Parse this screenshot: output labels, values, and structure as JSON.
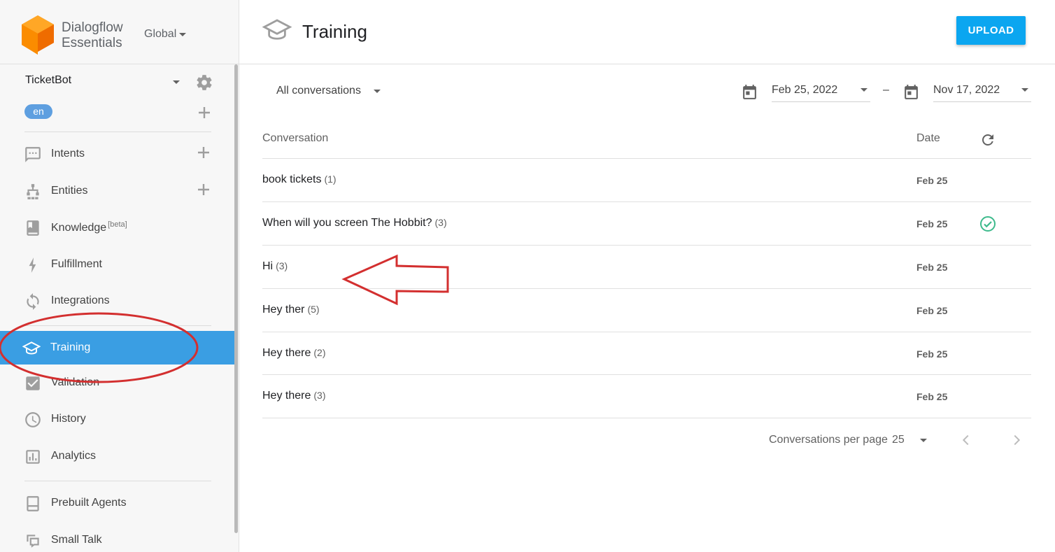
{
  "brand": {
    "name_line1": "Dialogflow",
    "name_line2": "Essentials",
    "region": "Global",
    "logo_color": "#f57c00"
  },
  "agent": {
    "name": "TicketBot",
    "language": "en"
  },
  "sidebar": {
    "items": [
      {
        "label": "Intents",
        "icon": "chat-bubble-icon",
        "has_add": true
      },
      {
        "label": "Entities",
        "icon": "hierarchy-icon",
        "has_add": true
      },
      {
        "label": "Knowledge",
        "badge": "[beta]",
        "icon": "book-icon"
      },
      {
        "label": "Fulfillment",
        "icon": "lightning-icon"
      },
      {
        "label": "Integrations",
        "icon": "sync-icon"
      },
      {
        "label": "Training",
        "icon": "graduation-cap-icon",
        "active": true
      },
      {
        "label": "Validation",
        "icon": "checkbox-icon"
      },
      {
        "label": "History",
        "icon": "clock-icon"
      },
      {
        "label": "Analytics",
        "icon": "bar-chart-icon"
      },
      {
        "label": "Prebuilt Agents",
        "icon": "bookmark-book-icon"
      },
      {
        "label": "Small Talk",
        "icon": "speech-bubbles-icon"
      }
    ],
    "active_color": "#3a9ee3"
  },
  "header": {
    "title": "Training",
    "upload_label": "UPLOAD",
    "upload_color": "#0ba6f0"
  },
  "filters": {
    "conversation_filter": "All conversations",
    "date_from": "Feb 25, 2022",
    "date_separator": "–",
    "date_to": "Nov 17, 2022"
  },
  "table": {
    "columns": {
      "conversation": "Conversation",
      "date": "Date"
    },
    "rows": [
      {
        "text": "book tickets",
        "count": "(1)",
        "date": "Feb 25",
        "reviewed": false
      },
      {
        "text": "When will you screen The Hobbit?",
        "count": "(3)",
        "date": "Feb 25",
        "reviewed": true
      },
      {
        "text": "Hi",
        "count": "(3)",
        "date": "Feb 25",
        "reviewed": false
      },
      {
        "text": "Hey ther",
        "count": "(5)",
        "date": "Feb 25",
        "reviewed": false
      },
      {
        "text": "Hey there",
        "count": "(2)",
        "date": "Feb 25",
        "reviewed": false
      },
      {
        "text": "Hey there",
        "count": "(3)",
        "date": "Feb 25",
        "reviewed": false
      }
    ],
    "reviewed_color": "#3dba8c"
  },
  "pagination": {
    "label": "Conversations per page",
    "per_page": "25"
  },
  "annotations": {
    "color": "#d32f2f"
  }
}
